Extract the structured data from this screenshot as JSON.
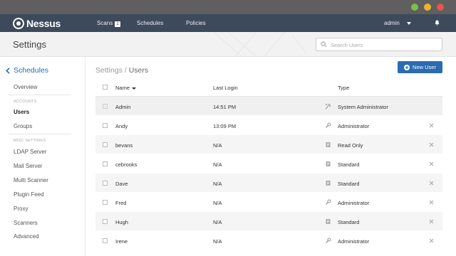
{
  "window": {
    "controls": [
      "green",
      "yellow",
      "red"
    ]
  },
  "topnav": {
    "logo": "Nessus",
    "scans_label": "Scans",
    "scans_count": "1",
    "schedules_label": "Schedules",
    "policies_label": "Policies",
    "user_label": "admin"
  },
  "header": {
    "title": "Settings",
    "search_placeholder": "Search Users"
  },
  "sidebar": {
    "back_label": "Schedules",
    "overview": "Overview",
    "accounts_heading": "ACCOUNTS",
    "users": "Users",
    "groups": "Groups",
    "misc_heading": "MISC SETTINGS",
    "ldap": "LDAP Server",
    "mail": "Mail Server",
    "multi": "Multi Scanner",
    "plugin": "Plugin Feed",
    "proxy": "Proxy",
    "scanners": "Scanners",
    "advanced": "Advanced"
  },
  "main": {
    "breadcrumb_parent": "Settings",
    "breadcrumb_sep": " / ",
    "breadcrumb_current": "Users",
    "new_user_label": "New User",
    "columns": {
      "name": "Name",
      "last_login": "Last Login",
      "type": "Type"
    },
    "rows": [
      {
        "name": "Admin",
        "last_login": "14:51 PM",
        "type": "System Administrator",
        "icon": "tools-icon"
      },
      {
        "name": "Andy",
        "last_login": "13:09 PM",
        "type": "Administrator",
        "icon": "wrench-icon"
      },
      {
        "name": "bevans",
        "last_login": "N/A",
        "type": "Read Only",
        "icon": "document-icon"
      },
      {
        "name": "cebrooks",
        "last_login": "N/A",
        "type": "Standard",
        "icon": "document-icon"
      },
      {
        "name": "Dave",
        "last_login": "N/A",
        "type": "Standard",
        "icon": "document-icon"
      },
      {
        "name": "Fred",
        "last_login": "N/A",
        "type": "Administrator",
        "icon": "wrench-icon"
      },
      {
        "name": "Hugh",
        "last_login": "N/A",
        "type": "Standard",
        "icon": "document-icon"
      },
      {
        "name": "Irene",
        "last_login": "N/A",
        "type": "Administrator",
        "icon": "wrench-icon"
      }
    ]
  },
  "colors": {
    "nav_bg": "#3d4a5c",
    "accent": "#2b6cb0"
  }
}
